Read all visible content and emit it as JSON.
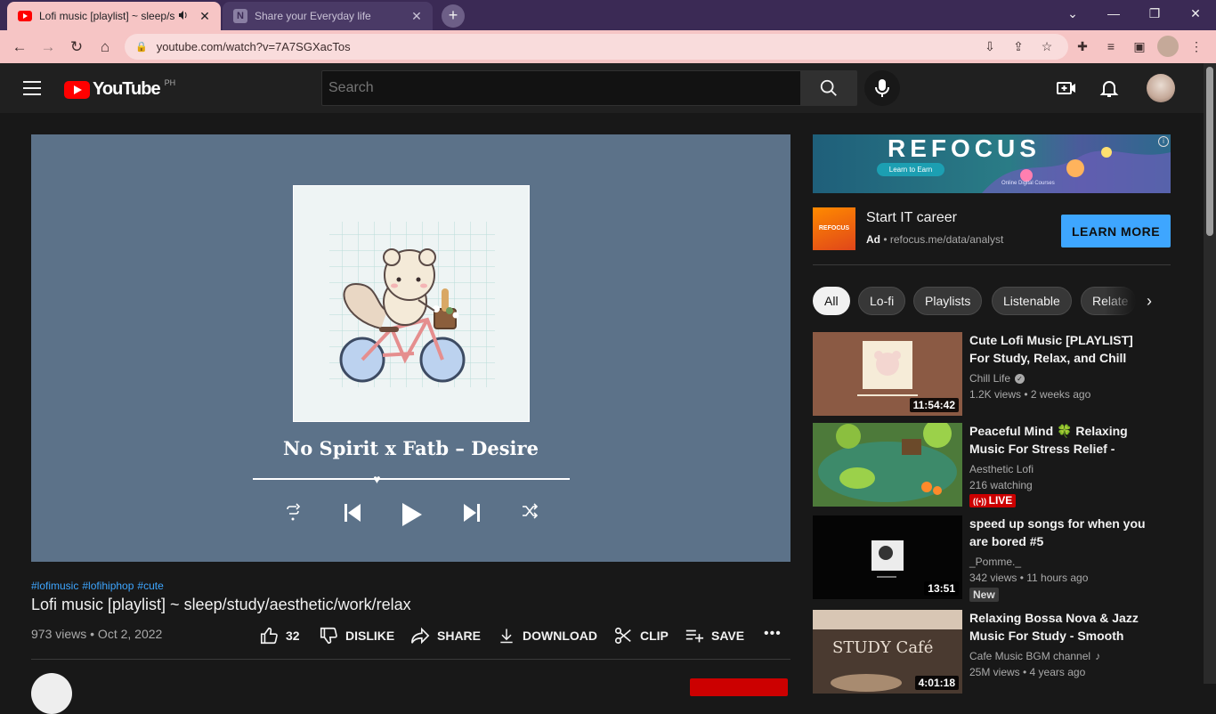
{
  "browser": {
    "tabs": [
      {
        "title": "Lofi music [playlist] ~ sleep/s",
        "active": true
      },
      {
        "title": "Share your Everyday life",
        "active": false
      }
    ],
    "new_tab": "+",
    "url": "youtube.com/watch?v=7A7SGXacTos"
  },
  "header": {
    "logo_text": "YouTube",
    "country_code": "PH",
    "search_placeholder": "Search"
  },
  "video": {
    "song_title": "No Spirit x Fatb – Desire",
    "progress": 0.38,
    "hashtags": [
      "#lofimusic",
      "#lofihiphop",
      "#cute"
    ],
    "title": "Lofi music [playlist] ~ sleep/study/aesthetic/work/relax",
    "meta": "973 views • Oct 2, 2022",
    "actions": {
      "like_count": "32",
      "dislike": "DISLIKE",
      "share": "SHARE",
      "download": "DOWNLOAD",
      "clip": "CLIP",
      "save": "SAVE"
    }
  },
  "ad": {
    "banner_brand": "REFOCUS",
    "banner_cta": "Learn to Earn",
    "banner_sub": "Online Digital Courses",
    "logo_text": "REFOCUS",
    "title": "Start IT career",
    "ad_label": "Ad",
    "url": "refocus.me/data/analyst",
    "button": "LEARN MORE"
  },
  "chips": [
    "All",
    "Lo-fi",
    "Playlists",
    "Listenable",
    "Relate"
  ],
  "related": [
    {
      "title": "Cute Lofi Music [PLAYLIST] For Study, Relax, and Chill",
      "channel": "Chill Life",
      "views": "1.2K views • 2 weeks ago",
      "duration": "11:54:42"
    },
    {
      "title": "Peaceful Mind 🍀 Relaxing Music For Stress Relief - Lofi…",
      "channel": "Aesthetic Lofi",
      "views": "216 watching",
      "badge": "LIVE"
    },
    {
      "title": "speed up songs for when you are bored #5",
      "channel": "_Pomme._",
      "views": "342 views • 11 hours ago",
      "duration": "13:51",
      "badge": "New"
    },
    {
      "title": "Relaxing Bossa Nova & Jazz Music For Study - Smooth Jaz…",
      "channel": "Cafe Music BGM channel",
      "views": "25M views • 4 years ago",
      "duration": "4:01:18"
    }
  ],
  "colors": {
    "accent_blue": "#3ea6ff",
    "brand_red": "#ff0000",
    "player_bg": "#5c7289",
    "tab_active": "#f6c5c5"
  }
}
